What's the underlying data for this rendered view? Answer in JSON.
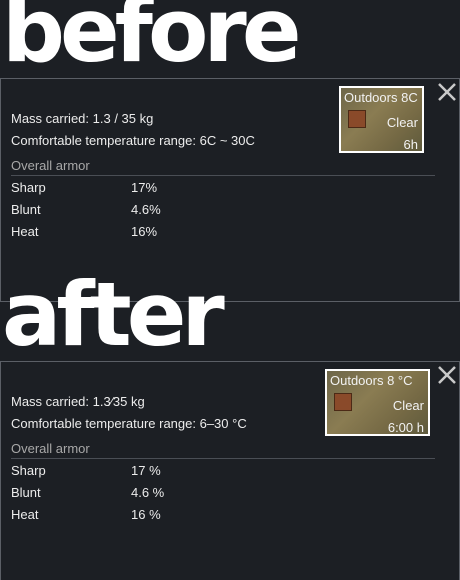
{
  "before": {
    "heading": "before",
    "weather": {
      "title": "Outdoors 8C",
      "condition": "Clear",
      "time": "6h"
    },
    "mass": "Mass carried: 1.3 / 35 kg",
    "comfort": "Comfortable temperature range: 6C ~ 30C",
    "armor_title": "Overall armor",
    "armor": [
      {
        "name": "Sharp",
        "value": "17%"
      },
      {
        "name": "Blunt",
        "value": "4.6%"
      },
      {
        "name": "Heat",
        "value": "16%"
      }
    ]
  },
  "after": {
    "heading": "after",
    "weather": {
      "title": "Outdoors 8 °C",
      "condition": "Clear",
      "time": "6:00 h"
    },
    "mass": "Mass carried: 1.3⁄35 kg",
    "comfort": "Comfortable temperature range: 6–30 °C",
    "armor_title": "Overall armor",
    "armor": [
      {
        "name": "Sharp",
        "value": "17 %"
      },
      {
        "name": "Blunt",
        "value": "4.6 %"
      },
      {
        "name": "Heat",
        "value": "16 %"
      }
    ]
  },
  "icons": {
    "close": "close-icon",
    "weather": "weather-swatch-icon"
  },
  "colors": {
    "background": "#1c1f24",
    "border": "#5b5f66",
    "muted_text": "#a8a8a8",
    "weather_box": "#7a6f4a"
  }
}
